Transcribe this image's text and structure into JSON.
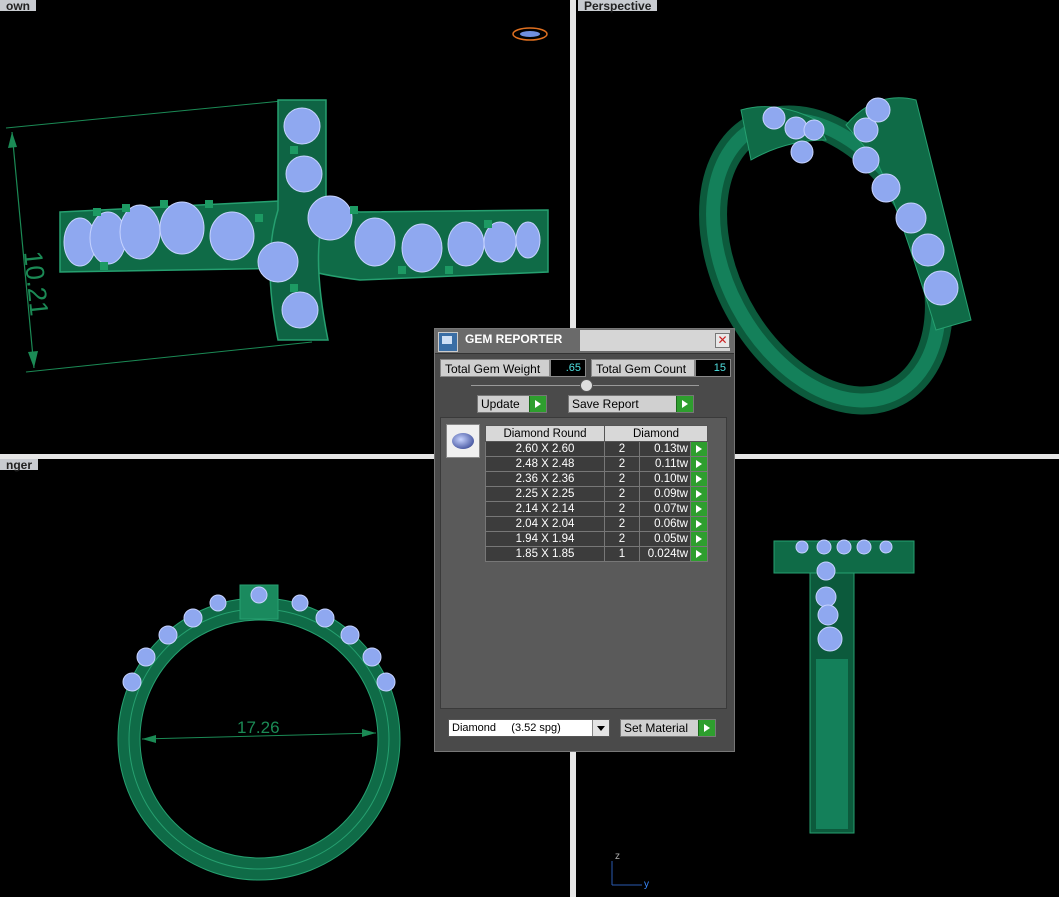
{
  "viewports": {
    "top_label": "own",
    "perspective_label": "Perspective",
    "front_label": "nger",
    "dimension_width": "10.21",
    "dimension_ring": "17.26",
    "axis_z": "z",
    "axis_y": "y"
  },
  "gem_reporter": {
    "title": "GEM REPORTER",
    "total_weight_label": "Total Gem Weight",
    "total_weight_value": ".65",
    "total_count_label": "Total Gem Count",
    "total_count_value": "15",
    "update_label": "Update",
    "save_report_label": "Save Report",
    "table_header_shape": "Diamond Round",
    "table_header_material": "Diamond",
    "rows": [
      {
        "size": "2.60 X 2.60",
        "count": "2",
        "weight": "0.13tw"
      },
      {
        "size": "2.48 X 2.48",
        "count": "2",
        "weight": "0.11tw"
      },
      {
        "size": "2.36 X 2.36",
        "count": "2",
        "weight": "0.10tw"
      },
      {
        "size": "2.25 X 2.25",
        "count": "2",
        "weight": "0.09tw"
      },
      {
        "size": "2.14 X 2.14",
        "count": "2",
        "weight": "0.07tw"
      },
      {
        "size": "2.04 X 2.04",
        "count": "2",
        "weight": "0.06tw"
      },
      {
        "size": "1.94 X 1.94",
        "count": "2",
        "weight": "0.05tw"
      },
      {
        "size": "1.85 X 1.85",
        "count": "1",
        "weight": "0.024tw"
      }
    ],
    "material_select": "Diamond     (3.52 spg)",
    "set_material_label": "Set Material"
  },
  "colors": {
    "metal": "#0f6b47",
    "gem": "#8fa8f0",
    "dimension": "#1b8a55"
  }
}
